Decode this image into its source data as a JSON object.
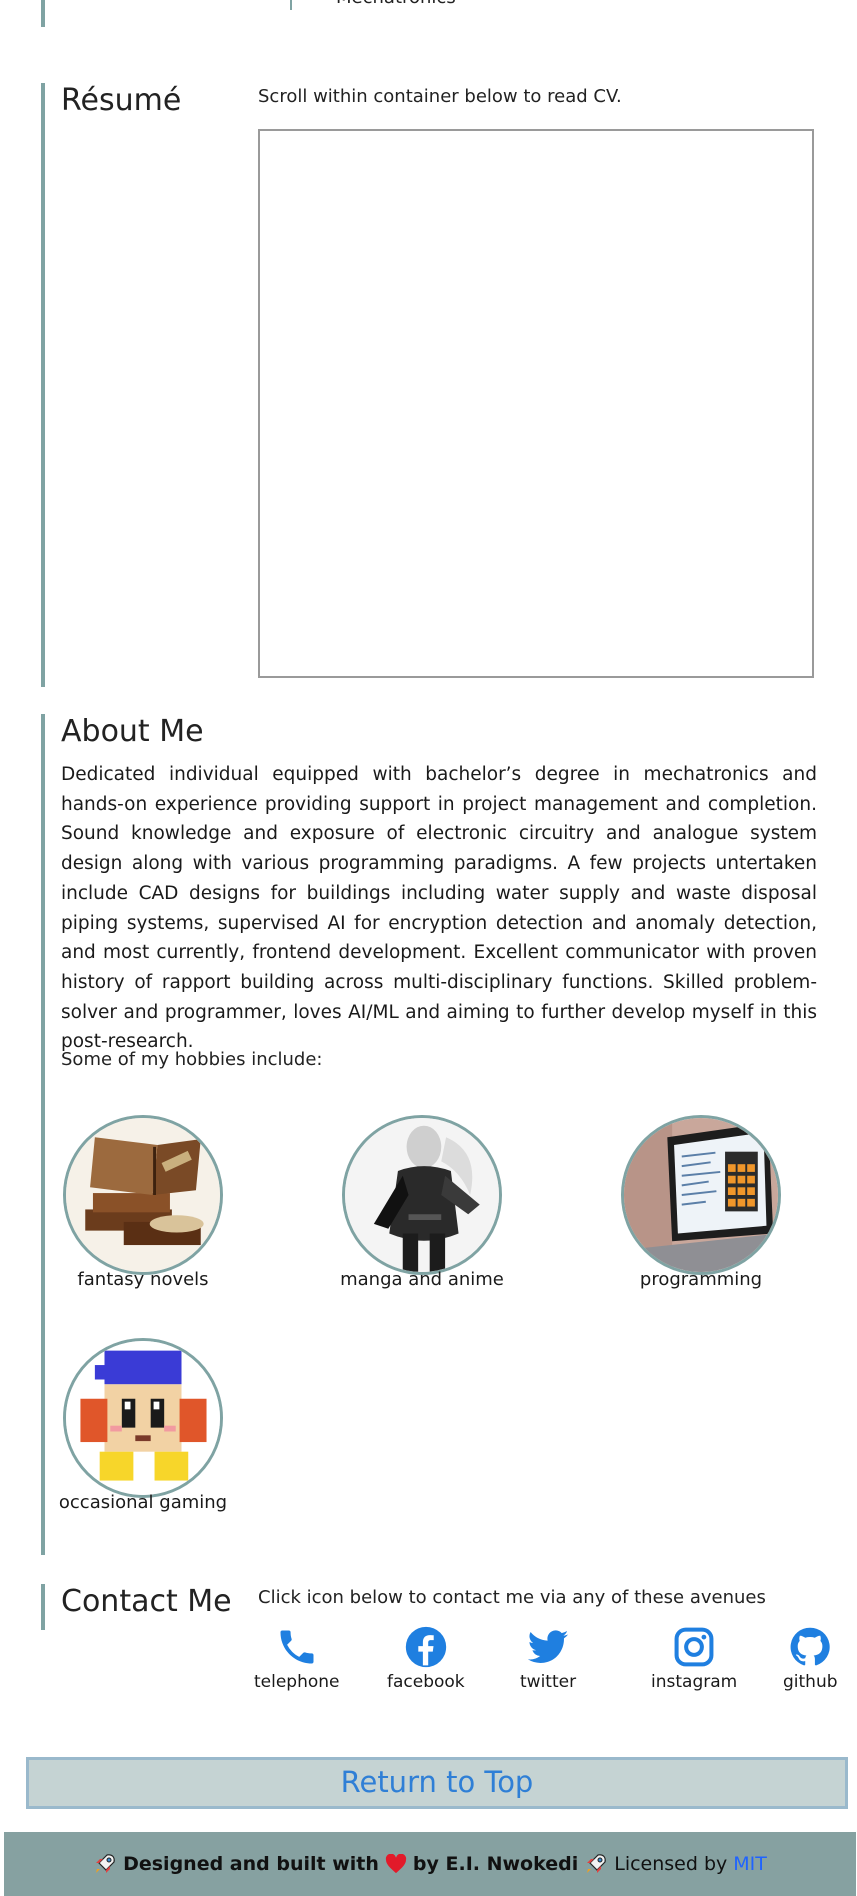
{
  "top_fragment": {
    "text": "Mechatronics"
  },
  "resume": {
    "title": "Résumé",
    "note": "Scroll within container below to read CV."
  },
  "about": {
    "title": "About Me",
    "paragraph": "Dedicated individual equipped with bachelor’s degree in mechatronics and hands-on experience providing support in project management and completion. Sound knowledge and exposure of electronic circuitry and analogue system design along with various programming paradigms. A few projects untertaken include CAD designs for buildings including water supply and waste disposal piping systems, supervised AI for encryption detection and anomaly detection, and most currently, frontend development. Excellent communicator with proven history of rapport building across multi-disciplinary functions. Skilled problem-solver and programmer, loves AI/ML and aiming to further develop myself in this post-research.",
    "hobbies_intro": "Some of my hobbies include:",
    "hobbies": [
      {
        "label": "fantasy novels",
        "icon": "books-scroll-image"
      },
      {
        "label": "manga and anime",
        "icon": "anime-hero-image"
      },
      {
        "label": "programming",
        "icon": "laptop-code-image"
      },
      {
        "label": "occasional gaming",
        "icon": "pixel-character-image"
      }
    ]
  },
  "contact": {
    "title": "Contact Me",
    "note": "Click icon below to contact me via any of these avenues",
    "items": [
      {
        "label": "telephone",
        "icon": "phone-icon"
      },
      {
        "label": "facebook",
        "icon": "facebook-icon"
      },
      {
        "label": "twitter",
        "icon": "twitter-icon"
      },
      {
        "label": "instagram",
        "icon": "instagram-icon"
      },
      {
        "label": "github",
        "icon": "github-icon"
      }
    ],
    "icon_color": "#1f7fe0"
  },
  "return_to_top": {
    "label": "Return to Top"
  },
  "footer": {
    "designed": "Designed and built with",
    "by": "by E.I. Nwokedi",
    "licensed": "Licensed by",
    "license": "MIT"
  },
  "colors": {
    "accent_bar": "#7fa3a3",
    "footer_bg": "#86a1a1",
    "link_blue": "#1f63ff",
    "button_bg": "#c5d3d3"
  }
}
